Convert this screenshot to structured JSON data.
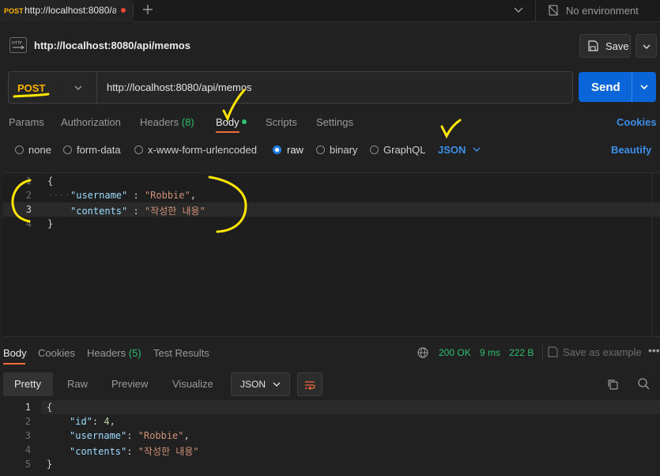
{
  "tabs": {
    "active": {
      "method": "POST",
      "url": "http://localhost:8080/a"
    }
  },
  "environment": {
    "label": "No environment"
  },
  "request": {
    "name": "http://localhost:8080/api/memos",
    "save_label": "Save",
    "method": "POST",
    "url": "http://localhost:8080/api/memos",
    "send_label": "Send"
  },
  "request_tabs": {
    "params": "Params",
    "authorization": "Authorization",
    "headers": "Headers",
    "headers_count": "(8)",
    "body": "Body",
    "scripts": "Scripts",
    "settings": "Settings",
    "cookies": "Cookies"
  },
  "body_types": {
    "none": "none",
    "form_data": "form-data",
    "urlencoded": "x-www-form-urlencoded",
    "raw": "raw",
    "binary": "binary",
    "graphql": "GraphQL",
    "format": "JSON",
    "beautify": "Beautify",
    "selected": "raw"
  },
  "request_body": {
    "line_numbers": [
      "1",
      "2",
      "3",
      "4"
    ],
    "open": "{",
    "username_key": "\"username\"",
    "username_value": "\"Robbie\"",
    "contents_key": "\"contents\"",
    "contents_value": "\"작성한 내용\"",
    "close": "}"
  },
  "response_tabs": {
    "body": "Body",
    "cookies": "Cookies",
    "headers": "Headers",
    "headers_count": "(5)",
    "test_results": "Test Results"
  },
  "response_status": {
    "status": "200 OK",
    "time": "9 ms",
    "size": "222 B",
    "save_example": "Save as example"
  },
  "response_views": {
    "pretty": "Pretty",
    "raw": "Raw",
    "preview": "Preview",
    "visualize": "Visualize",
    "format": "JSON"
  },
  "response_body": {
    "line_numbers": [
      "1",
      "2",
      "3",
      "4",
      "5"
    ],
    "open": "{",
    "id_key": "\"id\"",
    "id_value": "4",
    "username_key": "\"username\"",
    "username_value": "\"Robbie\"",
    "contents_key": "\"contents\"",
    "contents_value": "\"작성한 내용\"",
    "close": "}"
  },
  "colors": {
    "accent": "#0a66d8",
    "method": "#ffb400",
    "success": "#2fbf71",
    "link": "#3d8ee8",
    "annotation": "#ffe600"
  }
}
